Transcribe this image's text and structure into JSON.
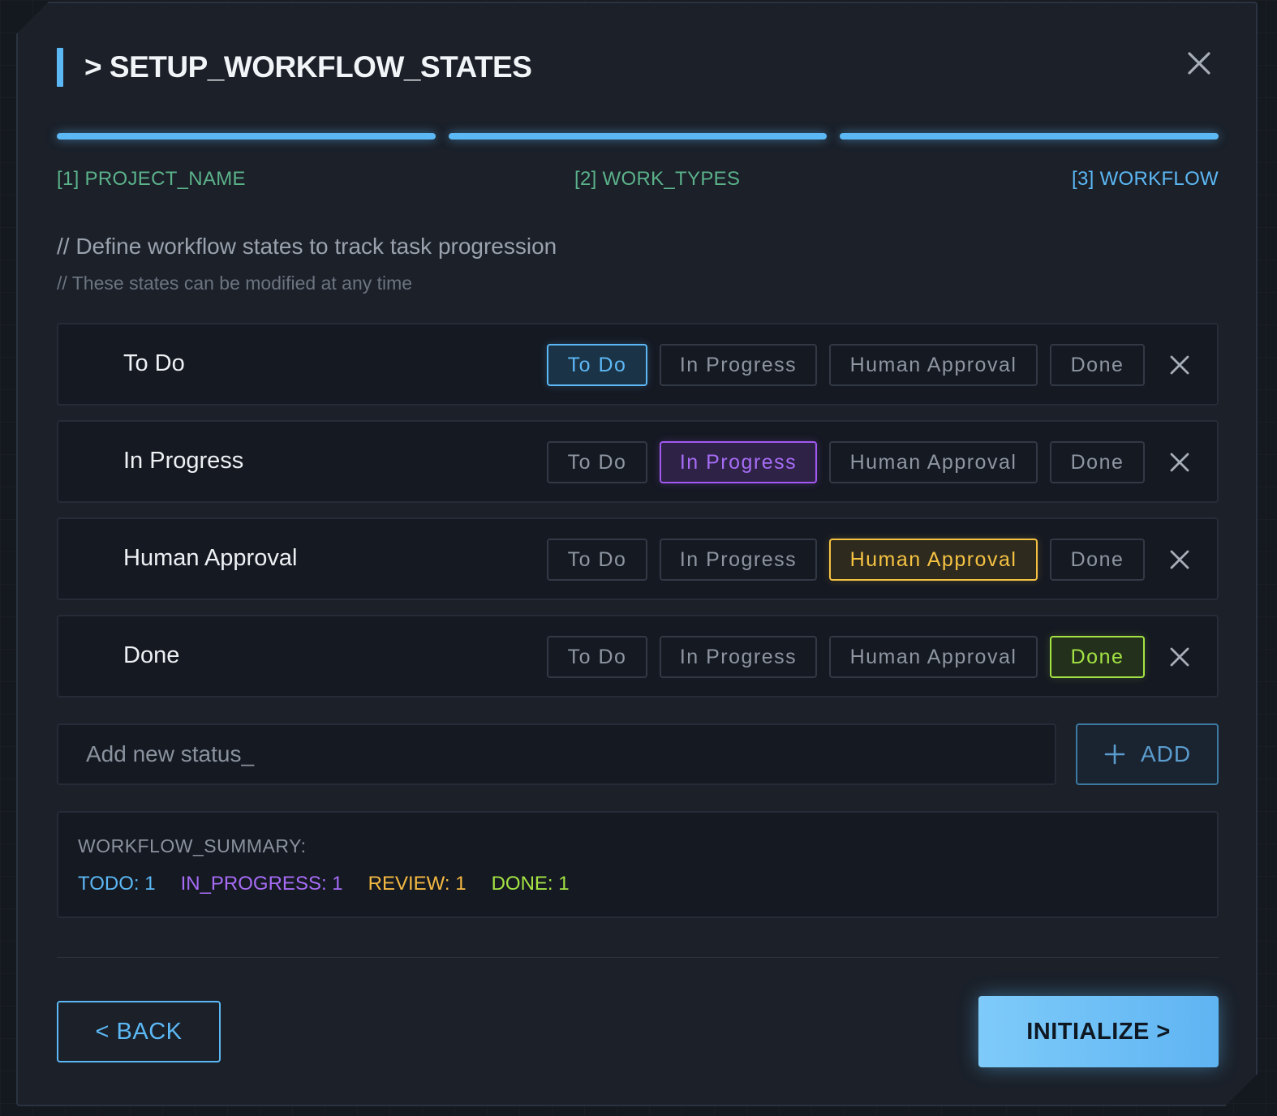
{
  "dialog": {
    "title": "> SETUP_WORKFLOW_STATES"
  },
  "steps": [
    {
      "label": "[1] PROJECT_NAME",
      "state": "complete"
    },
    {
      "label": "[2] WORK_TYPES",
      "state": "complete"
    },
    {
      "label": "[3] WORKFLOW",
      "state": "active"
    }
  ],
  "description": {
    "line1": "// Define workflow states to track task progression",
    "line2": "// These states can be modified at any time"
  },
  "category_options": [
    "To Do",
    "In Progress",
    "Human Approval",
    "Done"
  ],
  "statuses": [
    {
      "name": "To Do",
      "category": "To Do"
    },
    {
      "name": "In Progress",
      "category": "In Progress"
    },
    {
      "name": "Human Approval",
      "category": "Human Approval"
    },
    {
      "name": "Done",
      "category": "Done"
    }
  ],
  "add": {
    "placeholder": "Add new status_",
    "value": "",
    "button_label": "ADD"
  },
  "summary": {
    "label": "WORKFLOW_SUMMARY:",
    "todo": "TODO: 1",
    "in_progress": "IN_PROGRESS: 1",
    "review": "REVIEW: 1",
    "done": "DONE: 1"
  },
  "footer": {
    "back_label": "< BACK",
    "initialize_label": "INITIALIZE >"
  },
  "colors": {
    "accent": "#5cb8f5",
    "todo": "#5cb8f5",
    "in_progress": "#a259f2",
    "review": "#f5c242",
    "done": "#a4e344",
    "step_complete": "#5bb28a"
  },
  "icons": {
    "close": "close-icon",
    "remove": "close-icon",
    "add": "plus-icon"
  }
}
